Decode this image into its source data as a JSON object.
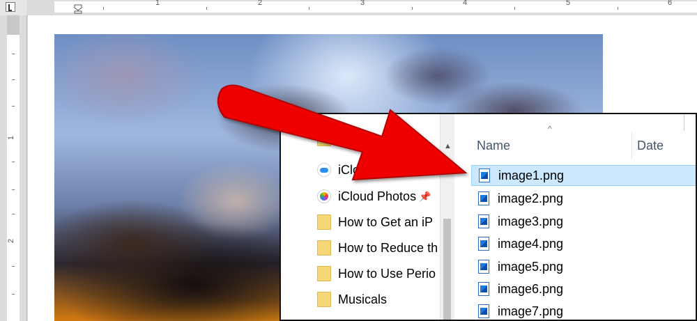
{
  "ruler": {
    "top_numbers": [
      "1",
      "2",
      "3",
      "4",
      "5",
      "6"
    ],
    "left_numbers": [
      "1",
      "2"
    ]
  },
  "explorer": {
    "nav_items": [
      {
        "label": "iCloud",
        "icon": "icloud-drive-icon"
      },
      {
        "label": "iCloud Photos",
        "icon": "icloud-photos-icon",
        "pinned": true
      },
      {
        "label": "How to Get an iP",
        "icon": "folder-icon"
      },
      {
        "label": "How to Reduce th",
        "icon": "folder-icon"
      },
      {
        "label": "How to Use Perio",
        "icon": "folder-icon"
      },
      {
        "label": "Musicals",
        "icon": "folder-icon"
      }
    ],
    "columns": {
      "name": "Name",
      "date": "Date"
    },
    "files": [
      {
        "name": "image1.png",
        "selected": true
      },
      {
        "name": "image2.png"
      },
      {
        "name": "image3.png"
      },
      {
        "name": "image4.png"
      },
      {
        "name": "image5.png"
      },
      {
        "name": "image6.png"
      },
      {
        "name": "image7.png"
      }
    ]
  },
  "colors": {
    "arrow": "#ee0000",
    "selection_bg": "#cce8ff",
    "selection_border": "#99d1ff",
    "folder": "#f5d77a"
  }
}
